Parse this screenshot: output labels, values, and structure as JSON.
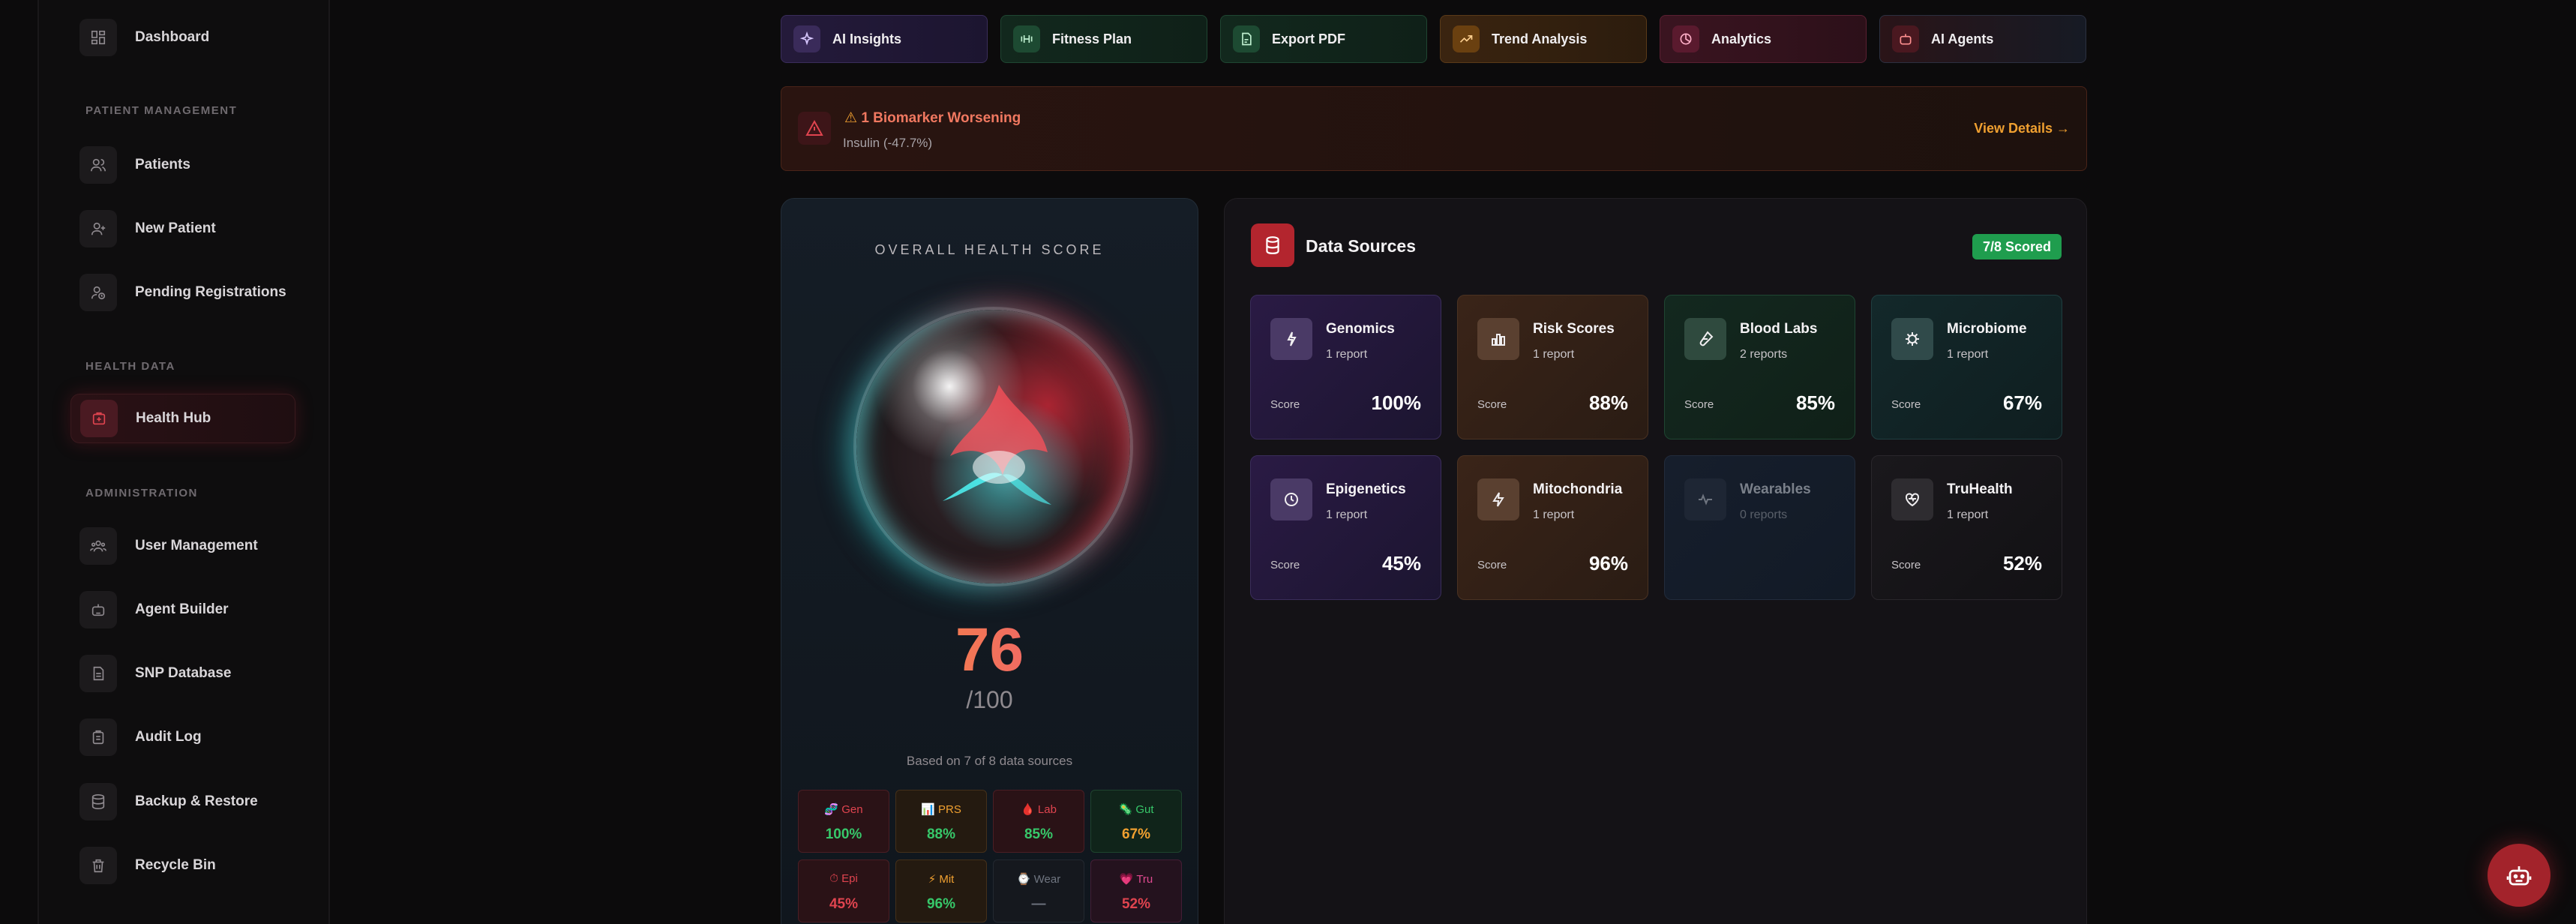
{
  "sidebar": {
    "items": [
      {
        "label": "Dashboard",
        "icon": "dashboard-icon"
      },
      {
        "label": "Patients",
        "icon": "users-icon"
      },
      {
        "label": "New Patient",
        "icon": "user-plus-icon"
      },
      {
        "label": "Pending Registrations",
        "icon": "user-clock-icon"
      },
      {
        "label": "Health Hub",
        "icon": "health-hub-icon"
      },
      {
        "label": "User Management",
        "icon": "user-group-icon"
      },
      {
        "label": "Agent Builder",
        "icon": "robot-icon"
      },
      {
        "label": "SNP Database",
        "icon": "document-icon"
      },
      {
        "label": "Audit Log",
        "icon": "clipboard-icon"
      },
      {
        "label": "Backup & Restore",
        "icon": "database-icon"
      },
      {
        "label": "Recycle Bin",
        "icon": "trash-icon"
      }
    ],
    "sections": {
      "patient_management": "PATIENT MANAGEMENT",
      "health_data": "HEALTH DATA",
      "administration": "ADMINISTRATION"
    }
  },
  "toolbar": {
    "buttons": [
      {
        "label": "AI Insights",
        "icon": "sparkles-icon"
      },
      {
        "label": "Fitness Plan",
        "icon": "dumbbell-icon"
      },
      {
        "label": "Export PDF",
        "icon": "file-icon"
      },
      {
        "label": "Trend Analysis",
        "icon": "trend-up-icon"
      },
      {
        "label": "Analytics",
        "icon": "analytics-icon"
      },
      {
        "label": "AI Agents",
        "icon": "robot-icon"
      }
    ]
  },
  "alert": {
    "title": "1 Biomarker Worsening",
    "detail": "Insulin (-47.7%)",
    "link": "View Details →"
  },
  "health_score": {
    "title": "OVERALL HEALTH SCORE",
    "score": "76",
    "max": "/100",
    "basis": "Based on 7 of 8 data sources",
    "breakdown": [
      {
        "label": "Gen",
        "value": "100%",
        "emoji": "🧬"
      },
      {
        "label": "PRS",
        "value": "88%",
        "emoji": "📊"
      },
      {
        "label": "Lab",
        "value": "85%",
        "emoji": "🩸"
      },
      {
        "label": "Gut",
        "value": "67%",
        "emoji": "🦠"
      },
      {
        "label": "Epi",
        "value": "45%",
        "emoji": "⏱"
      },
      {
        "label": "Mit",
        "value": "96%",
        "emoji": "⚡"
      },
      {
        "label": "Wear",
        "value": "—",
        "emoji": "⌚"
      },
      {
        "label": "Tru",
        "value": "52%",
        "emoji": "💗"
      }
    ]
  },
  "data_sources": {
    "title": "Data Sources",
    "badge": "7/8 Scored",
    "score_label": "Score",
    "cards": [
      {
        "name": "Genomics",
        "reports": "1 report",
        "score": "100%",
        "icon": "dna-icon"
      },
      {
        "name": "Risk Scores",
        "reports": "1 report",
        "score": "88%",
        "icon": "bar-chart-icon"
      },
      {
        "name": "Blood Labs",
        "reports": "2 reports",
        "score": "85%",
        "icon": "test-tube-icon"
      },
      {
        "name": "Microbiome",
        "reports": "1 report",
        "score": "67%",
        "icon": "microbe-icon"
      },
      {
        "name": "Epigenetics",
        "reports": "1 report",
        "score": "45%",
        "icon": "clock-icon"
      },
      {
        "name": "Mitochondria",
        "reports": "1 report",
        "score": "96%",
        "icon": "bolt-icon"
      },
      {
        "name": "Wearables",
        "reports": "0 reports",
        "score": "",
        "icon": "activity-icon"
      },
      {
        "name": "TruHealth",
        "reports": "1 report",
        "score": "52%",
        "icon": "heart-pulse-icon"
      }
    ]
  },
  "colors": {
    "accent": "#b3252e",
    "good": "#37c86a",
    "warn": "#f0a030",
    "bad": "#e0444f"
  }
}
